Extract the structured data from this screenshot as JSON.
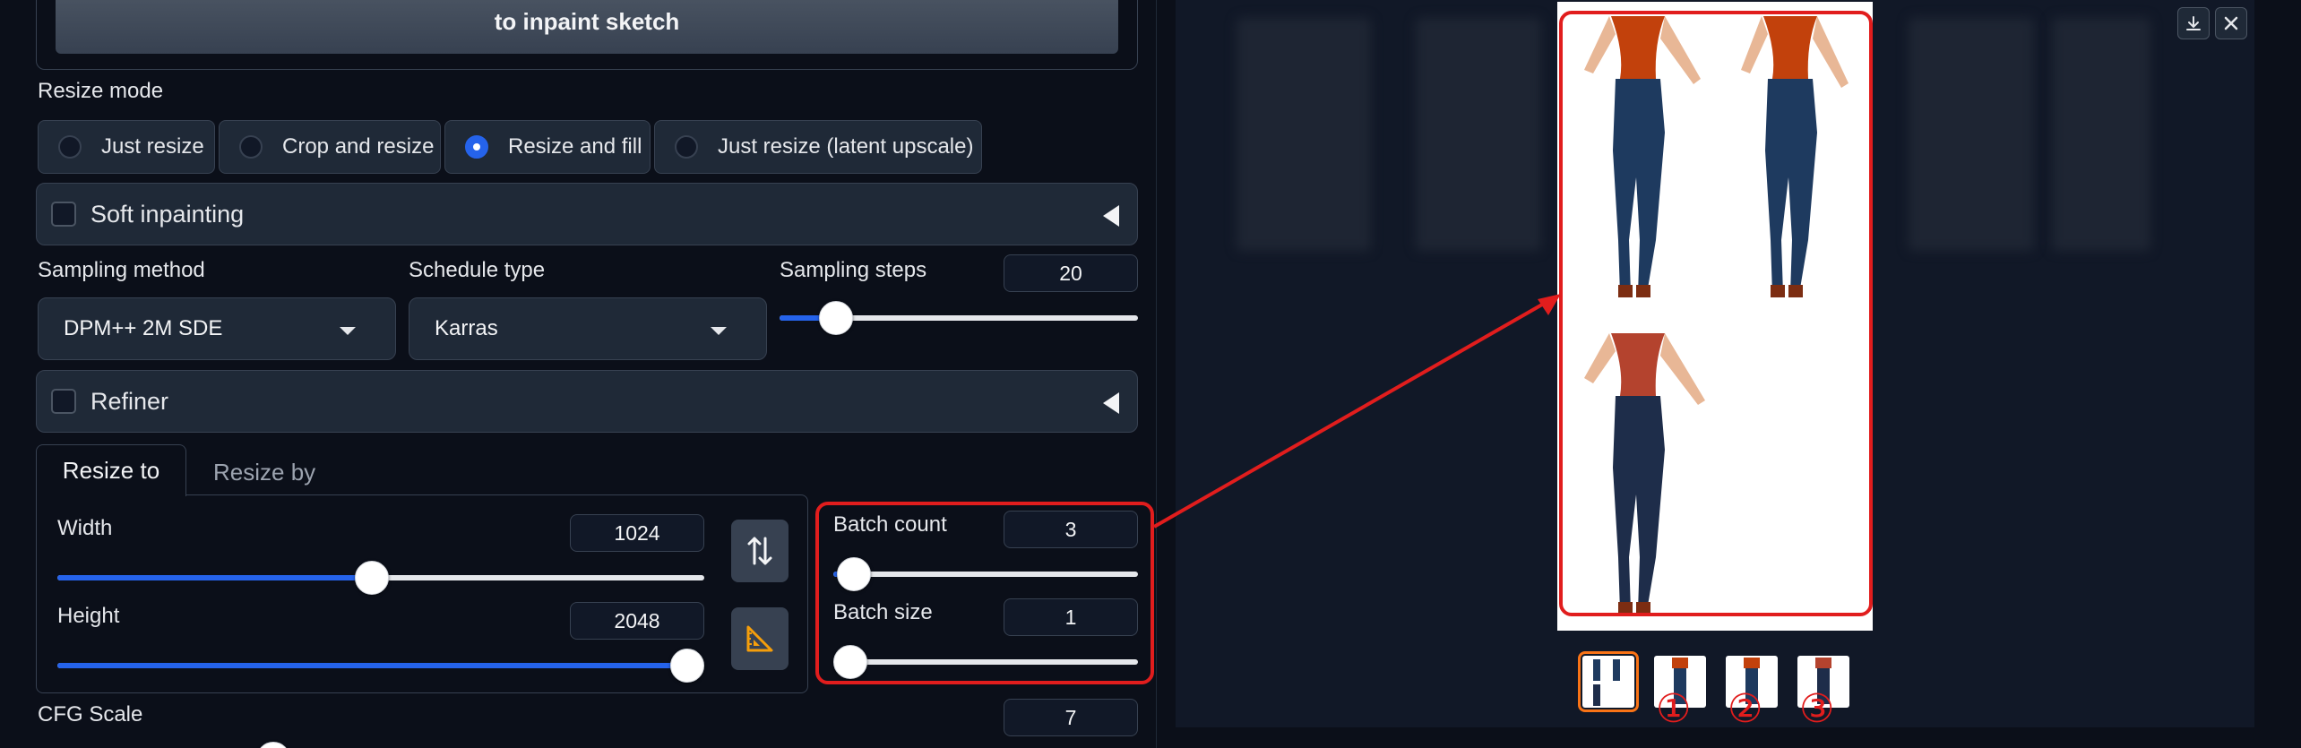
{
  "top_button": {
    "label": "to inpaint sketch"
  },
  "resize_mode": {
    "label": "Resize mode",
    "options": [
      "Just resize",
      "Crop and resize",
      "Resize and fill",
      "Just resize (latent upscale)"
    ],
    "selected": "Resize and fill"
  },
  "soft_inpainting": {
    "label": "Soft inpainting"
  },
  "sampling": {
    "method_label": "Sampling method",
    "method_value": "DPM++ 2M SDE",
    "schedule_label": "Schedule type",
    "schedule_value": "Karras",
    "steps_label": "Sampling steps",
    "steps_value": "20"
  },
  "refiner": {
    "label": "Refiner"
  },
  "resize_tabs": {
    "tab_to": "Resize to",
    "tab_by": "Resize by"
  },
  "dimensions": {
    "width_label": "Width",
    "width_value": "1024",
    "height_label": "Height",
    "height_value": "2048"
  },
  "batch": {
    "count_label": "Batch count",
    "count_value": "3",
    "size_label": "Batch size",
    "size_value": "1"
  },
  "cfg": {
    "label": "CFG Scale",
    "value": "7"
  },
  "thumbnails": {
    "numbers": [
      "①",
      "②",
      "③"
    ]
  },
  "colors": {
    "accent": "#2563eb",
    "annotation": "#e11d1d",
    "selected_thumb": "#f97316",
    "background": "#0b0f19",
    "panel": "#1f2937"
  },
  "icons": {
    "swap": "swap-dimensions-icon",
    "aspect": "aspect-ratio-icon",
    "download": "download-icon",
    "close": "close-icon"
  }
}
